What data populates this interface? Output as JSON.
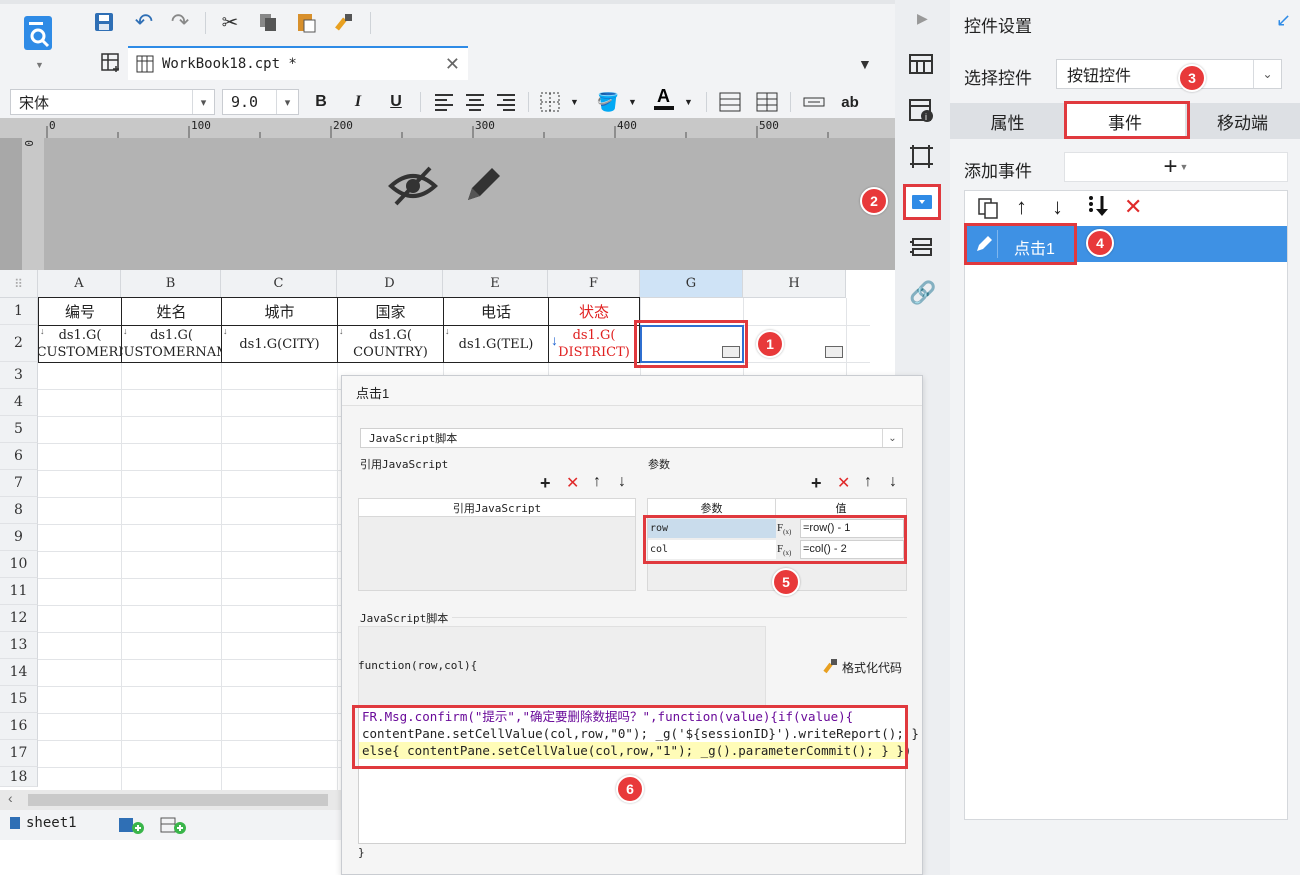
{
  "toolbar": {
    "tab_title": "WorkBook18.cpt *",
    "font_name": "宋体",
    "font_size": "9.0",
    "bold": "B",
    "italic": "I",
    "underline": "U",
    "text_ab": "ab"
  },
  "ruler": {
    "ticks": [
      "0",
      "100",
      "200",
      "300",
      "400",
      "500"
    ],
    "vtick": "0"
  },
  "grid": {
    "columns": [
      "A",
      "B",
      "C",
      "D",
      "E",
      "F",
      "G",
      "H"
    ],
    "rows": [
      "1",
      "2",
      "3",
      "4",
      "5",
      "6",
      "7",
      "8",
      "9",
      "10",
      "11",
      "12",
      "13",
      "14",
      "15",
      "16",
      "17",
      "18"
    ],
    "headers": [
      "编号",
      "姓名",
      "城市",
      "国家",
      "电话",
      "状态"
    ],
    "data_row": [
      "ds1.G(\nCUSTOMERI",
      "ds1.G(\nCUSTOMERNAM",
      "ds1.G(CITY)",
      "ds1.G(\nCOUNTRY)",
      "ds1.G(TEL)",
      "ds1.G(\nDISTRICT)"
    ]
  },
  "sheet_tab": "sheet1",
  "panel": {
    "title": "控件设置",
    "select_label": "选择控件",
    "select_value": "按钮控件",
    "tabs": [
      "属性",
      "事件",
      "移动端"
    ],
    "add_event_label": "添加事件",
    "event_item": "点击1"
  },
  "dialog": {
    "title": "点击1",
    "type_value": "JavaScript脚本",
    "ref_js_label": "引用JavaScript",
    "params_label": "参数",
    "ref_js_header": "引用JavaScript",
    "param_header": "参数",
    "value_header": "值",
    "params": [
      {
        "name": "row",
        "value": "=row() - 1"
      },
      {
        "name": "col",
        "value": "=col() - 2"
      }
    ],
    "script_label": "JavaScript脚本",
    "function_sig": "function(row,col){",
    "format_code": "格式化代码",
    "closing_brace": "}",
    "code_lines": [
      "FR.Msg.confirm(\"提示\",\"确定要删除数据吗？\",function(value){if(value){",
      "contentPane.setCellValue(col,row,\"0\"); _g('${sessionID}').writeReport(); }",
      "else{ contentPane.setCellValue(col,row,\"1\"); _g().parameterCommit(); } })"
    ]
  },
  "badges": [
    "1",
    "2",
    "3",
    "4",
    "5",
    "6"
  ],
  "colors": {
    "accent": "#2f8be6",
    "highlight_red": "#e0393e",
    "selected_blue": "#3e91e4"
  }
}
